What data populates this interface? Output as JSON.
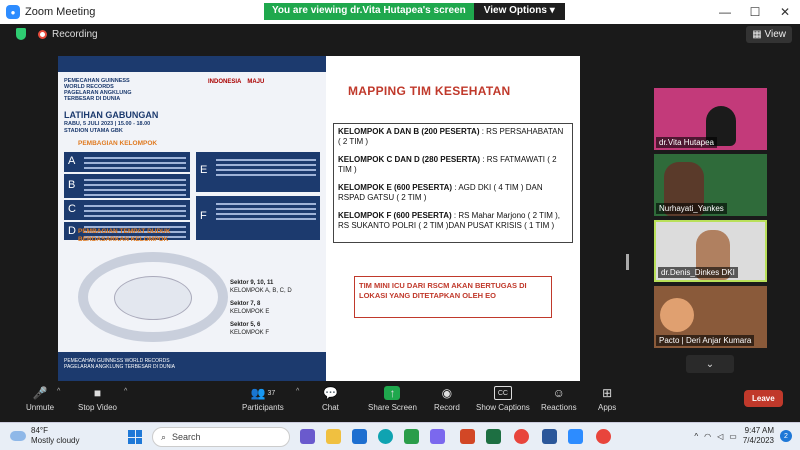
{
  "window": {
    "title": "Zoom Meeting",
    "minimize": "—",
    "maximize": "☐",
    "close": "✕"
  },
  "viewing_banner": {
    "message": "You are viewing dr.Vita Hutapea's screen",
    "options_label": "View Options"
  },
  "status": {
    "recording_label": "Recording",
    "view_label": "View"
  },
  "slide": {
    "infographic": {
      "subtitle": "PEMECAHAN GUINNESS WORLD RECORDS PAGELARAN ANGKLUNG TERBESAR DI DUNIA",
      "title": "LATIHAN GABUNGAN",
      "date": "RABU, 5 JULI 2023 | 15.00 - 18.00 STADION UTAMA GBK",
      "section1": "PEMBAGIAN KELOMPOK",
      "section2": "PEMBAGIAN TEMPAT DUDUK BERDASARKAN KELOMPOK",
      "groups": [
        "A",
        "B",
        "C",
        "D",
        "E",
        "F"
      ],
      "sectors": [
        "Sektor 9, 10, 11",
        "KELOMPOK A, B, C, D",
        "Sektor 7, 8",
        "KELOMPOK E",
        "Sektor 5, 6",
        "KELOMPOK F"
      ],
      "logos": [
        "INDONESIA",
        "MAJU"
      ],
      "footer": "PEMECAHAN GUINNESS WORLD RECORDS PAGELARAN ANGKLUNG TERBESAR DI DUNIA"
    },
    "mapping_title": "MAPPING TIM KESEHATAN",
    "mapping": [
      {
        "group": "KELOMPOK A DAN B (200 PESERTA)",
        "detail": " : RS PERSAHABATAN ( 2 TIM )"
      },
      {
        "group": "KELOMPOK C DAN D (280 PESERTA)",
        "detail": " : RS FATMAWATI ( 2 TIM )"
      },
      {
        "group": "KELOMPOK E (600 PESERTA)",
        "detail": " : AGD DKI ( 4 TIM ) DAN RSPAD GATSU ( 2 TIM )"
      },
      {
        "group": "KELOMPOK F (600 PESERTA)",
        "detail": " : RS Mahar Marjono ( 2 TIM ), RS SUKANTO POLRI ( 2 TIM )DAN PUSAT KRISIS ( 1 TIM )"
      }
    ],
    "icu_note": "TIM MINI ICU DARI RSCM AKAN BERTUGAS DI LOKASI YANG DITETAPKAN OLEH EO"
  },
  "participants": [
    {
      "name": "dr.Vita Hutapea",
      "bg": "#c33a7a"
    },
    {
      "name": "Nurhayati_Yankes",
      "bg": "#2f6b3a"
    },
    {
      "name": "dr.Denis_Dinkes DKI",
      "bg": "#dcdcdc"
    },
    {
      "name": "Pacto | Deri Anjar Kumara",
      "bg": "#8a5a3a"
    }
  ],
  "toolbar": {
    "unmute": "Unmute",
    "stop_video": "Stop Video",
    "participants": "Participants",
    "participant_count": "37",
    "chat": "Chat",
    "share_screen": "Share Screen",
    "record": "Record",
    "show_captions": "Show Captions",
    "captions_badge": "CC",
    "reactions": "Reactions",
    "apps": "Apps",
    "leave": "Leave"
  },
  "taskbar": {
    "temperature": "84°F",
    "weather": "Mostly cloudy",
    "search_placeholder": "Search",
    "time": "9:47 AM",
    "date": "7/4/2023",
    "notifications": "2"
  },
  "colors": {
    "accent": "#2d8cff",
    "share_green": "#1fa84d",
    "leave_red": "#c0392b",
    "slide_navy": "#1c3a6e"
  }
}
